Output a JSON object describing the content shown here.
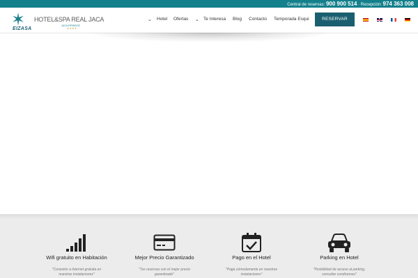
{
  "topbar": {
    "central_label": "Central de reservas:",
    "central_number": "900 900 514",
    "reception_label": "· Recepción:",
    "reception_number": "974 363 008"
  },
  "logo": {
    "brand": "EIZASA",
    "icon": "star-logo-icon"
  },
  "hotel": {
    "name": "HOTEL&SPA REAL JACA",
    "subtitle": "JACA-PIRINEOS",
    "stars": "★★★★"
  },
  "nav": {
    "items": [
      {
        "label": "Hotel",
        "dropdown": true
      },
      {
        "label": "Ofertas",
        "dropdown": false
      },
      {
        "label": "Te Interesa",
        "dropdown": true
      },
      {
        "label": "Blog",
        "dropdown": false
      },
      {
        "label": "Contacto",
        "dropdown": false
      },
      {
        "label": "Temporada Esqui",
        "dropdown": false
      }
    ],
    "cta": "RESERVAR",
    "languages": [
      "es",
      "en",
      "fr",
      "de"
    ]
  },
  "features": [
    {
      "icon": "wifi-signal-icon",
      "title": "Wifi gratuito en Habitación",
      "desc": "\"Conexión a Internet gratuita en nuestras instalaciones\""
    },
    {
      "icon": "credit-card-icon",
      "title": "Mejor Precio Garantizado",
      "desc": "\"Tus reservas con el mejor precio garantizado\""
    },
    {
      "icon": "calendar-check-icon",
      "title": "Pago en el Hotel",
      "desc": "\"Paga cómodamente en nuestras instalaciones\""
    },
    {
      "icon": "car-icon",
      "title": "Parking en Hotel",
      "desc": "\"Posibilidad de acceso al parking, consultar condiciones\""
    }
  ],
  "colors": {
    "teal": "#14808c",
    "dark_teal": "#1a5f6f",
    "feature_bg": "#ececec"
  }
}
